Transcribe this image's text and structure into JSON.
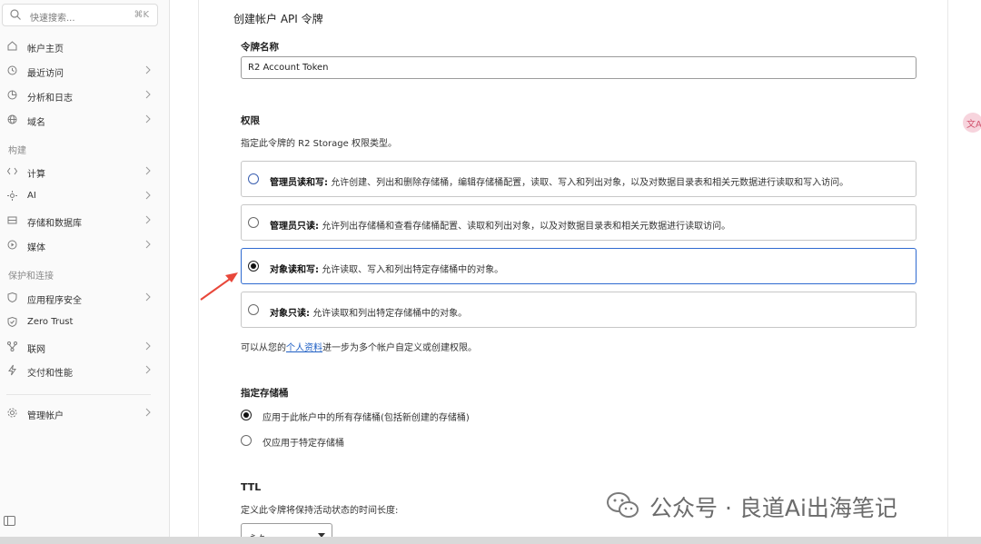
{
  "sidebar": {
    "search_placeholder": "快速搜索...",
    "search_shortcut": "⌘K",
    "items": [
      {
        "label": "帐户主页",
        "icon": "home-icon"
      },
      {
        "label": "最近访问",
        "icon": "clock-icon"
      },
      {
        "label": "分析和日志",
        "icon": "chart-icon"
      },
      {
        "label": "域名",
        "icon": "globe-icon"
      },
      {
        "label": "计算",
        "icon": "compute-icon"
      },
      {
        "label": "AI",
        "icon": "ai-icon"
      },
      {
        "label": "存储和数据库",
        "icon": "database-icon"
      },
      {
        "label": "媒体",
        "icon": "media-icon"
      },
      {
        "label": "应用程序安全",
        "icon": "shield-icon"
      },
      {
        "label": "Zero Trust",
        "icon": "zero-trust-icon"
      },
      {
        "label": "联网",
        "icon": "network-icon"
      },
      {
        "label": "交付和性能",
        "icon": "bolt-icon"
      },
      {
        "label": "管理帐户",
        "icon": "gear-icon"
      }
    ],
    "section_build": "构建",
    "section_protect": "保护和连接"
  },
  "form": {
    "title": "创建帐户 API 令牌",
    "token_name_label": "令牌名称",
    "token_name_value": "R2 Account Token",
    "permissions_label": "权限",
    "permissions_desc": "指定此令牌的 R2 Storage 权限类型。",
    "permissions": [
      {
        "title": "管理员读和写:",
        "desc": "允许创建、列出和删除存储桶，编辑存储桶配置，读取、写入和列出对象，以及对数据目录表和相关元数据进行读取和写入访问。",
        "selected": false
      },
      {
        "title": "管理员只读:",
        "desc": "允许列出存储桶和查看存储桶配置、读取和列出对象，以及对数据目录表和相关元数据进行读取访问。",
        "selected": false
      },
      {
        "title": "对象读和写:",
        "desc": "允许读取、写入和列出特定存储桶中的对象。",
        "selected": true
      },
      {
        "title": "对象只读:",
        "desc": "允许读取和列出特定存储桶中的对象。",
        "selected": false
      }
    ],
    "profile_note_before": "可以从您的",
    "profile_link": "个人资料",
    "profile_note_after": "进一步为多个帐户自定义或创建权限。",
    "bucket_label": "指定存储桶",
    "bucket_options": [
      {
        "label": "应用于此帐户中的所有存储桶(包括新创建的存储桶)",
        "selected": true
      },
      {
        "label": "仅应用于特定存储桶",
        "selected": false
      }
    ],
    "ttl_label": "TTL",
    "ttl_desc": "定义此令牌将保持活动状态的时间长度:",
    "ttl_value": "永久"
  },
  "watermark": "公众号 · 良道Ai出海笔记",
  "translate_button": "文A",
  "colors": {
    "accent": "#2f6ad0",
    "link": "#1f5fc4",
    "arrow": "#e8473a"
  }
}
